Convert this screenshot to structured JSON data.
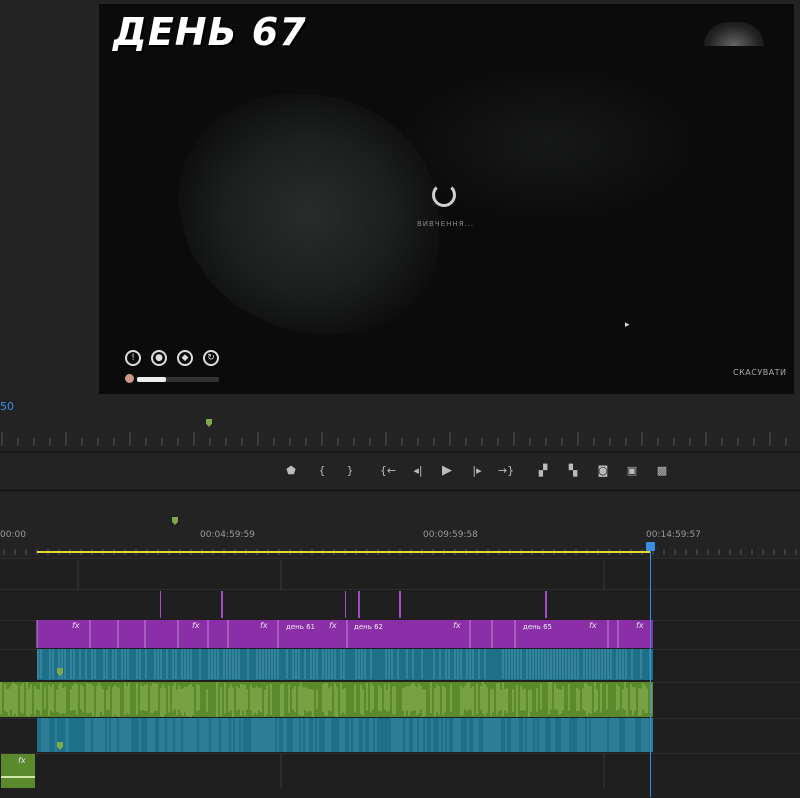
{
  "preview": {
    "title": "ДЕНЬ 67",
    "loading_label": "ВИВЧЕННЯ...",
    "cancel_label": "СКАСУВАТИ",
    "stat_icons": [
      "thermometer-icon",
      "eye-icon",
      "drop-icon",
      "stomach-icon"
    ],
    "health_fraction": 0.35
  },
  "source_monitor": {
    "timecode": "50"
  },
  "transport": {
    "buttons": [
      "add-marker",
      "mark-in",
      "mark-out",
      "go-to-in",
      "step-back",
      "play",
      "step-forward",
      "go-to-out",
      "insert",
      "overwrite",
      "export-frame",
      "button-editor",
      "multicam"
    ]
  },
  "timeline": {
    "timecodes": [
      "00:00",
      "00:04:59:59",
      "00:09:59:58",
      "00:14:59:57"
    ],
    "clip_labels": [
      "день 61",
      "день 62",
      "день 65"
    ],
    "fx_label": "fx",
    "colors": {
      "video_clip": "#8a2fa8",
      "video_clip_light": "#a24bc2",
      "audio_clip": "#1d6f8a",
      "green_clip": "#5a8a2c",
      "playhead": "#3a8ee6",
      "work_area": "#e6d832"
    }
  }
}
